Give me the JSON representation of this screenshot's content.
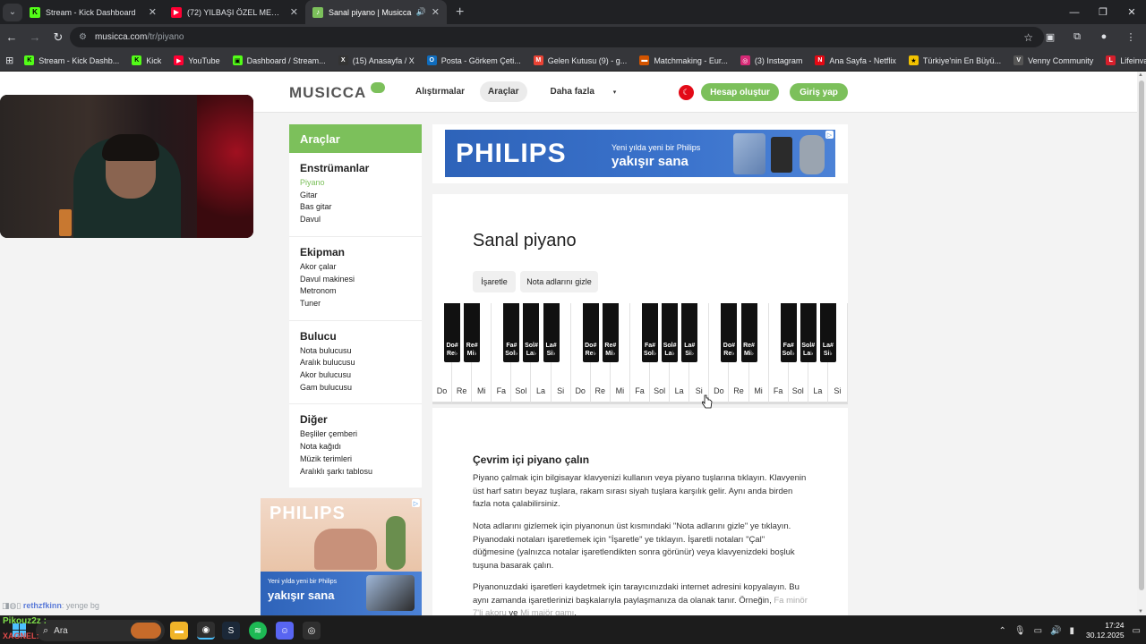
{
  "browser": {
    "tabs": [
      {
        "title": "Stream - Kick Dashboard",
        "favicon": "kick-icon",
        "color": "#53fc18"
      },
      {
        "title": "(72) YILBAŞI ÖZEL MEKİP KOMİ",
        "favicon": "youtube-icon",
        "color": "#ff0033"
      },
      {
        "title": "Sanal piyano | Musicca",
        "favicon": "musicca-icon",
        "color": "#7cc05b"
      }
    ],
    "url_host": "musicca.com",
    "url_path": "/tr/piyano",
    "bookmarks": [
      {
        "label": "Stream - Kick Dashb...",
        "color": "#53fc18",
        "icon": "K"
      },
      {
        "label": "Kick",
        "color": "#53fc18",
        "icon": "K"
      },
      {
        "label": "YouTube",
        "color": "#ff0033",
        "icon": "▶"
      },
      {
        "label": "Dashboard / Stream...",
        "color": "#53fc18",
        "icon": "▣"
      },
      {
        "label": "(15) Anasayfa / X",
        "color": "#333333",
        "icon": "X"
      },
      {
        "label": "Posta - Görkem Çeti...",
        "color": "#0f6cbd",
        "icon": "O"
      },
      {
        "label": "Gelen Kutusu (9) - g...",
        "color": "#ea4335",
        "icon": "M"
      },
      {
        "label": "Matchmaking - Eur...",
        "color": "#d35400",
        "icon": "▬"
      },
      {
        "label": "(3) Instagram",
        "color": "#d62976",
        "icon": "◎"
      },
      {
        "label": "Ana Sayfa - Netflix",
        "color": "#e50914",
        "icon": "N"
      },
      {
        "label": "Türkiye'nin En Büyü...",
        "color": "#f2c200",
        "icon": "★"
      },
      {
        "label": "Venny Community",
        "color": "#dddddd",
        "icon": "V"
      },
      {
        "label": "Lifeinvader - VennyV",
        "color": "#d61f2c",
        "icon": "L"
      }
    ]
  },
  "site": {
    "logo": "MUSICCA",
    "nav": [
      "Alıştırmalar",
      "Araçlar",
      "Daha fazla"
    ],
    "create_account": "Hesap oluştur",
    "login": "Giriş yap"
  },
  "sidebar": {
    "title": "Araçlar",
    "sections": [
      {
        "heading": "Enstrümanlar",
        "items": [
          "Piyano",
          "Gitar",
          "Bas gitar",
          "Davul"
        ]
      },
      {
        "heading": "Ekipman",
        "items": [
          "Akor çalar",
          "Davul makinesi",
          "Metronom",
          "Tuner"
        ]
      },
      {
        "heading": "Bulucu",
        "items": [
          "Nota bulucusu",
          "Aralık bulucusu",
          "Akor bulucusu",
          "Gam bulucusu"
        ]
      },
      {
        "heading": "Diğer",
        "items": [
          "Beşliler çemberi",
          "Nota kağıdı",
          "Müzik terimleri",
          "Aralıklı şarkı tablosu"
        ]
      }
    ]
  },
  "ads": {
    "brand": "PHILIPS",
    "slogan_small": "Yeni yılda yeni bir Philips",
    "slogan_big": "yakışır sana"
  },
  "main": {
    "title": "Sanal piyano",
    "mark_button": "İşaretle",
    "hide_names_button": "Nota adlarını gizle",
    "white_keys": [
      "Do",
      "Re",
      "Mi",
      "Fa",
      "Sol",
      "La",
      "Si",
      "Do",
      "Re",
      "Mi",
      "Fa",
      "Sol",
      "La",
      "Si",
      "Do",
      "Re",
      "Mi",
      "Fa",
      "Sol",
      "La",
      "Si"
    ],
    "black_keys": [
      "Do# Re♭",
      "Re# Mi♭",
      "Fa# Sol♭",
      "Sol# La♭",
      "La# Si♭",
      "Do# Re♭",
      "Re# Mi♭",
      "Fa# Sol♭",
      "Sol# La♭",
      "La# Si♭",
      "Do# Re♭",
      "Re# Mi♭",
      "Fa# Sol♭",
      "Sol# La♭",
      "La# Si♭"
    ],
    "section_title": "Çevrim içi piyano çalın",
    "p1": "Piyano çalmak için bilgisayar klavyenizi kullanın veya piyano tuşlarına tıklayın. Klavyenin üst harf satırı beyaz tuşlara, rakam sırası siyah tuşlara karşılık gelir. Aynı anda birden fazla nota çalabilirsiniz.",
    "p2": "Nota adlarını gizlemek için piyanonun üst kısmındaki \"Nota adlarını gizle\" ye tıklayın. Piyanodaki notaları işaretlemek için \"İşaretle\" ye tıklayın. İşaretli notaları \"Çal\" düğmesine (yalnızca notalar işaretlendikten sonra görünür) veya klavyenizdeki boşluk tuşuna basarak çalın.",
    "p3_a": "Piyanonuzdaki işaretleri kaydetmek için tarayıcınızdaki internet adresini kopyalayın. Bu aynı zamanda işaretlerinizi başkalarıyla paylaşmanıza da olanak tanır. Örneğin,",
    "p3_link1": "Fa minör 7'li akoru",
    "p3_mid": "ve",
    "p3_link2": "Mi majör gamı",
    "p3_end": "."
  },
  "overlay": {
    "chat_user": "rethzfkinn",
    "chat_msg": ": yenge bg",
    "chat_user2": "Pikouz2z :",
    "chat_user3": "XAGNEL:"
  },
  "taskbar": {
    "search_label": "Ara",
    "time": "17:24",
    "date": "30.12.2025"
  }
}
